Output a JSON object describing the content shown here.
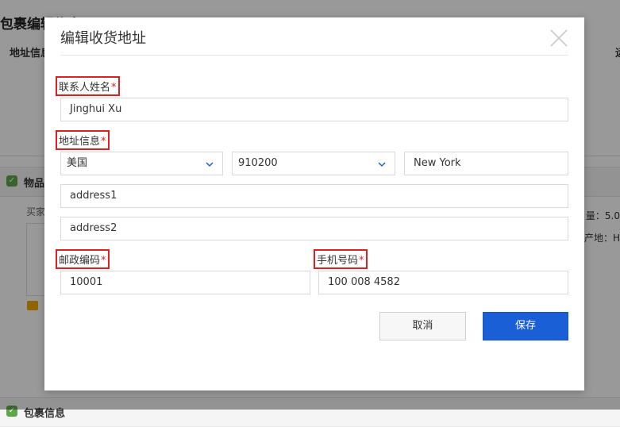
{
  "background": {
    "page_title": "包裹编辑信息",
    "address_section_label": "地址信息",
    "right_stub": "运",
    "products_section": "物品",
    "buyer_label": "买家",
    "quantity_text": "量：5.0",
    "origin_text": "产地：H",
    "package_section": "包裹信息"
  },
  "modal": {
    "title": "编辑收货地址",
    "contact_name": {
      "label": "联系人姓名",
      "required_mark": "*",
      "value": "Jinghui Xu"
    },
    "address": {
      "label": "地址信息",
      "required_mark": "*",
      "country": "美国",
      "region": "910200",
      "city": "New York",
      "address1": "address1",
      "address2": "address2"
    },
    "postal_code": {
      "label": "邮政编码",
      "required_mark": "*",
      "value": "10001"
    },
    "phone": {
      "label": "手机号码",
      "required_mark": "*",
      "value": "100 008 4582"
    },
    "buttons": {
      "cancel": "取消",
      "save": "保存"
    }
  },
  "colors": {
    "primary": "#1b5fd6",
    "required": "#e02020",
    "highlight_border": "#e02020"
  },
  "icons": [
    "close-icon",
    "chevron-down-icon",
    "check-icon",
    "chat-icon"
  ]
}
